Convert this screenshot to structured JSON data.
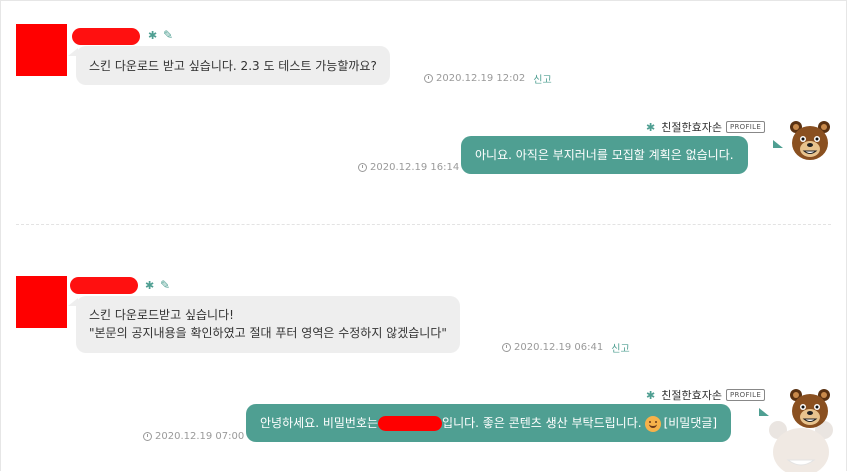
{
  "colors": {
    "accent": "#4f9f92",
    "redaction": "#ff0000",
    "bubble_gray": "#eeeeee"
  },
  "comments": [
    {
      "message_lines": [
        "스킨 다운로드 받고 싶습니다. 2.3 도 테스트 가능할까요?"
      ],
      "timestamp": "2020.12.19 12:02",
      "report_label": "신고"
    },
    {
      "author": "친절한효자손",
      "badge": "PROFILE",
      "message": "아니요. 아직은 부지러너를 모집할 계획은 없습니다.",
      "timestamp": "2020.12.19 16:14",
      "avatar_icon": "bear-icon"
    },
    {
      "message_lines": [
        "스킨 다운로드받고 싶습니다!",
        "\"본문의 공지내용을 확인하였고 절대 푸터 영역은 수정하지 않겠습니다\""
      ],
      "timestamp": "2020.12.19 06:41",
      "report_label": "신고"
    },
    {
      "author": "친절한효자손",
      "badge": "PROFILE",
      "message_before": "안녕하세요. 비밀번호는",
      "message_after": "입니다. 좋은 콘텐츠 생산 부탁드립니다.",
      "secret_label": "[비밀댓글]",
      "timestamp": "2020.12.19 07:00",
      "avatar_icon": "bear-icon"
    }
  ]
}
